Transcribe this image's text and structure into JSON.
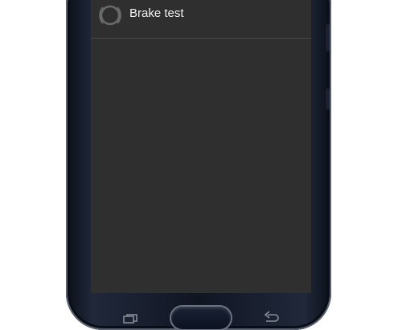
{
  "menu": {
    "items": [
      {
        "label": "Brake test",
        "icon": "brake-disc-icon"
      }
    ]
  },
  "navigation": {
    "recent_icon": "recent-apps-icon",
    "home_icon": "home-button",
    "back_icon": "back-arrow-icon"
  },
  "colors": {
    "screen_background": "#2f2f2f",
    "text": "#f2f2f2",
    "icon": "#6a6a6a"
  }
}
